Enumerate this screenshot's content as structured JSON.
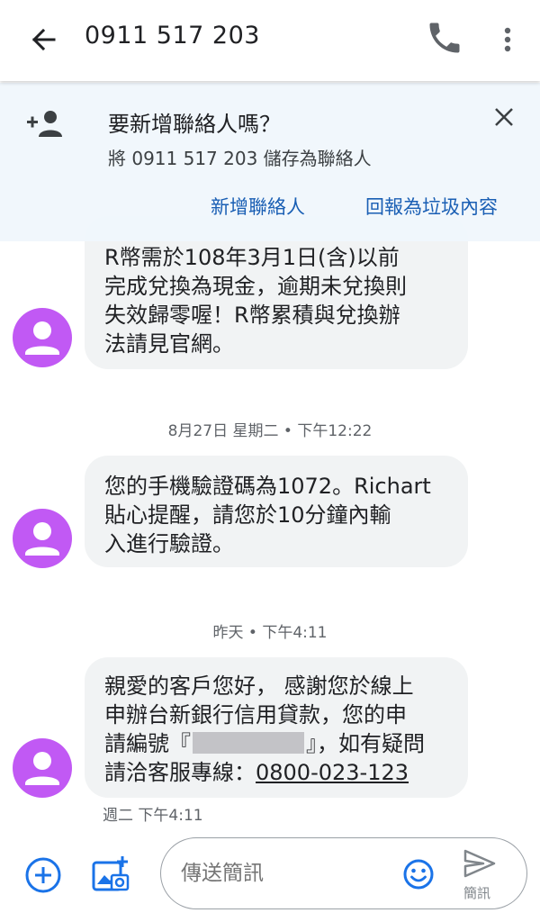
{
  "appbar": {
    "title": "0911 517 203",
    "icons": {
      "back": "arrow-back-icon",
      "call": "phone-icon",
      "more": "more-vert-icon"
    }
  },
  "banner": {
    "title": "要新增聯絡人嗎？",
    "subtitle": "將 0911 517 203 儲存為聯絡人",
    "add_contact": "新增聯絡人",
    "report_spam": "回報為垃圾內容",
    "icons": {
      "person_add": "person-add-icon",
      "close": "close-icon"
    }
  },
  "colors": {
    "accent_blue": "#1a5fb4",
    "avatar_purple": "#c159f4",
    "bubble_bg": "#f1f3f4",
    "banner_bg": "#f0f6fc"
  },
  "messages": [
    {
      "lines": [
        "R幣需於108年3月1日(含)以前",
        "完成兌換為現金，逾期未兌換則",
        "失效歸零喔！R幣累積與兌換辦",
        "法請見官網。"
      ]
    },
    {
      "timestamp": "8月27日 星期二 • 下午12:22",
      "lines": [
        "您的手機驗證碼為1072。Richart",
        "貼心提醒，請您於10分鐘內輸",
        "入進行驗證。"
      ]
    },
    {
      "timestamp": "昨天 • 下午4:11",
      "lines": [
        "親愛的客戶您好， 感謝您於線上",
        "申辦台新銀行信用貸款，您的申"
      ],
      "line3_prefix": "請編號『",
      "line3_suffix": "』，如有疑問",
      "line4_prefix": "請洽客服專線：",
      "hotline": "0800-023-123",
      "sub_time": "週二 下午4:11"
    }
  ],
  "composer": {
    "placeholder": "傳送簡訊",
    "send_label": "簡訊",
    "icons": {
      "add": "add-circle-icon",
      "media": "add-photo-icon",
      "emoji": "emoji-icon",
      "send": "send-icon"
    }
  }
}
